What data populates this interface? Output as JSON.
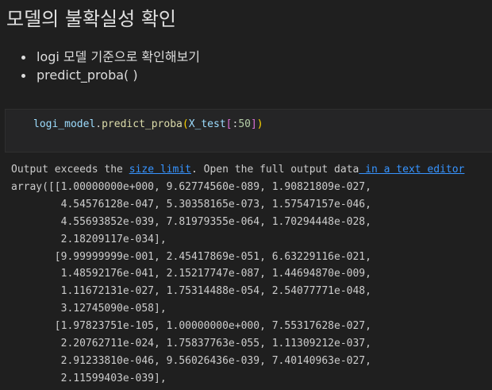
{
  "markdown": {
    "title": "모델의 불확실성 확인",
    "bullets": [
      "logi 모델 기준으로 확인해보기",
      "predict_proba( )"
    ]
  },
  "code_cell": {
    "obj": "logi_model",
    "dot": ".",
    "method": "predict_proba",
    "open_paren": "(",
    "arg": "X_test",
    "open_bracket": "[",
    "slice": ":",
    "number": "50",
    "close_bracket": "]",
    "close_paren": ")"
  },
  "output": {
    "notice_prefix": "Output exceeds the ",
    "size_limit_link": "size limit",
    "notice_middle": ". Open the full output data",
    "text_editor_link": " in a text editor",
    "lines": [
      "array([[1.00000000e+000, 9.62774560e-089, 1.90821809e-027,",
      "        4.54576128e-047, 5.30358165e-073, 1.57547157e-046,",
      "        4.55693852e-039, 7.81979355e-064, 1.70294448e-028,",
      "        2.18209117e-034],",
      "       [9.99999999e-001, 2.45417869e-051, 6.63229116e-021,",
      "        1.48592176e-041, 2.15217747e-087, 1.44694870e-009,",
      "        1.11672131e-027, 1.75314488e-054, 2.54077771e-048,",
      "        3.12745090e-058],",
      "       [1.97823751e-105, 1.00000000e+000, 7.55317628e-027,",
      "        2.20762711e-024, 1.75837763e-055, 1.11309212e-037,",
      "        2.91233810e-046, 9.56026436e-039, 7.40140963e-027,",
      "        2.11599403e-039],"
    ]
  },
  "colors": {
    "background": "#1f1f1f",
    "link": "#3794ff",
    "function": "#dcdcaa",
    "variable": "#9cdcfe"
  }
}
